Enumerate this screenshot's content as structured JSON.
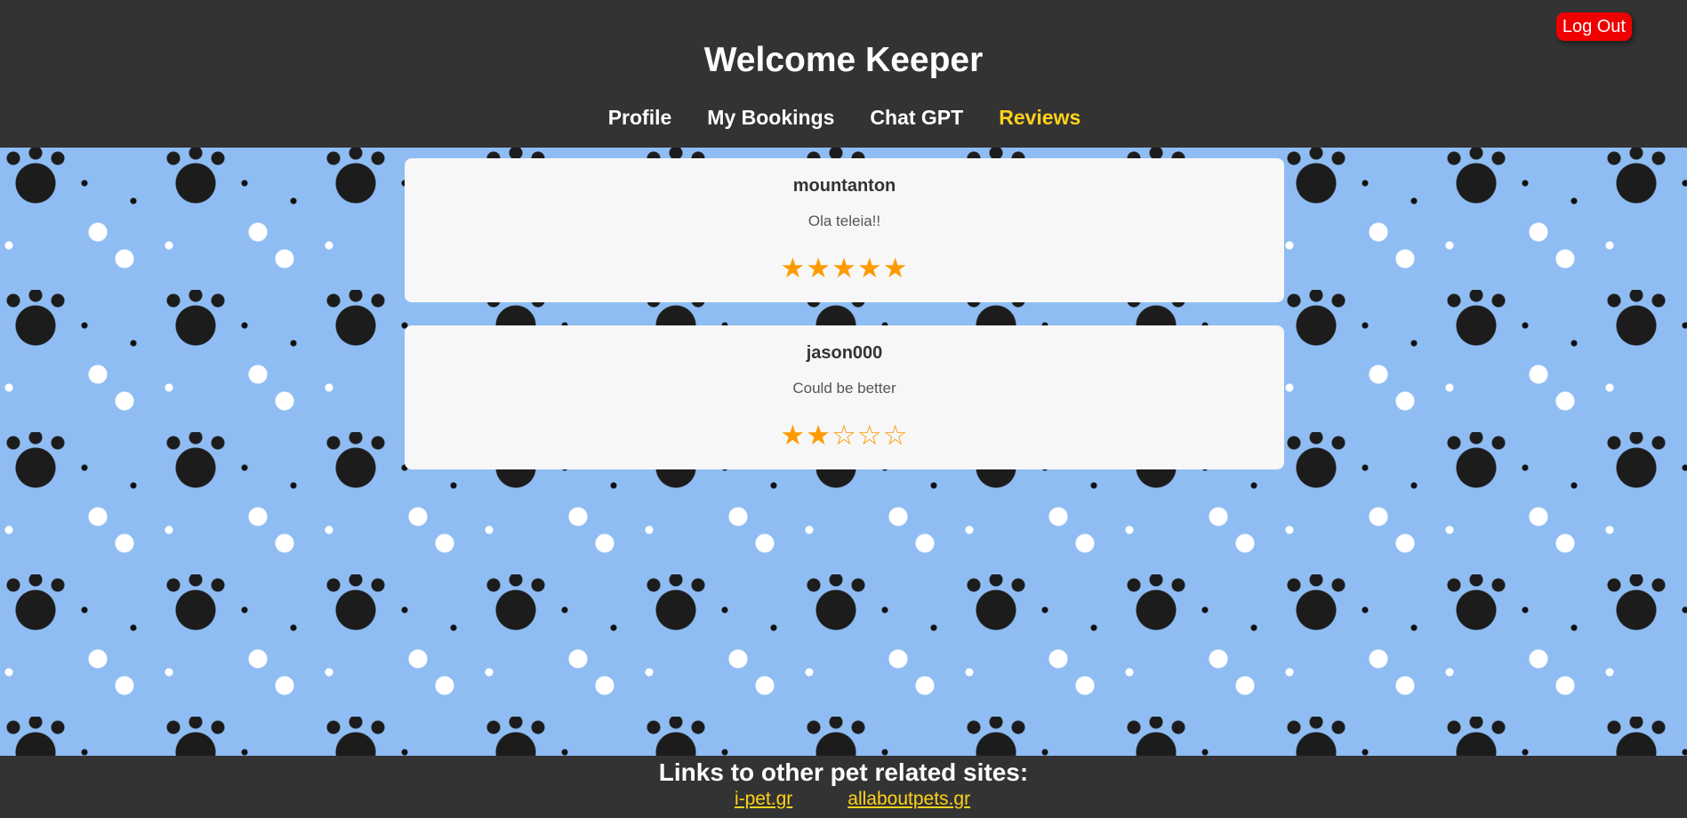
{
  "header": {
    "title": "Welcome Keeper",
    "logout_label": "Log Out",
    "nav": [
      {
        "label": "Profile"
      },
      {
        "label": "My Bookings"
      },
      {
        "label": "Chat GPT"
      },
      {
        "label": "Reviews",
        "active": true
      }
    ]
  },
  "reviews": [
    {
      "user": "mountanton",
      "comment": "Ola teleia!!",
      "rating": 5,
      "max_rating": 5
    },
    {
      "user": "jason000",
      "comment": "Could be better",
      "rating": 2,
      "max_rating": 5
    }
  ],
  "footer": {
    "heading": "Links to other pet related sites:",
    "links": [
      {
        "label": "i-pet.gr"
      },
      {
        "label": "allaboutpets.gr"
      }
    ]
  },
  "colors": {
    "header_bg": "#333333",
    "active_nav": "#ffd21a",
    "logout_bg": "#ee0000",
    "star": "#ff9a00",
    "card_bg": "#f7f7f7",
    "pattern_bg": "#8fbdf3"
  },
  "icons": {
    "filled_star": "star-filled-icon",
    "empty_star": "star-outline-icon",
    "background_pattern": "paw-and-bone-pattern"
  }
}
